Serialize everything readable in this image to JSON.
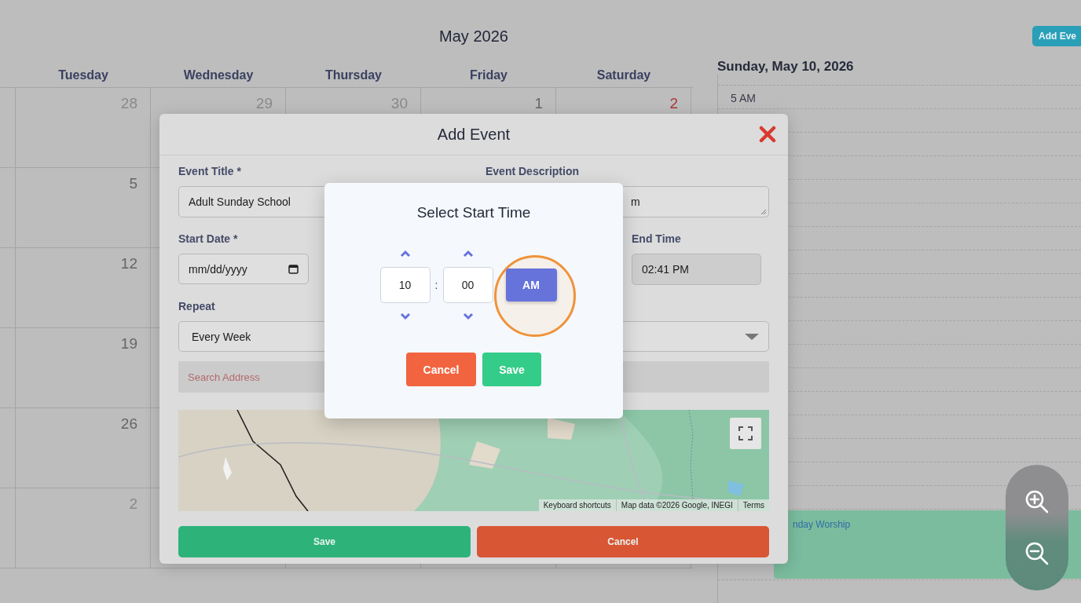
{
  "calendar": {
    "title": "May 2026",
    "weekdays": [
      "Tuesday",
      "Wednesday",
      "Thursday",
      "Friday",
      "Saturday"
    ],
    "weeks": [
      {
        "cells": [
          {
            "day": "28",
            "muted": true,
            "weekend": false
          },
          {
            "day": "29",
            "muted": true,
            "weekend": false
          },
          {
            "day": "30",
            "muted": true,
            "weekend": false
          },
          {
            "day": "1",
            "muted": false,
            "weekend": false
          },
          {
            "day": "2",
            "muted": false,
            "weekend": true
          }
        ]
      },
      {
        "cells": [
          {
            "day": "5",
            "muted": false,
            "weekend": false
          }
        ]
      },
      {
        "cells": [
          {
            "day": "12",
            "muted": false,
            "weekend": false
          }
        ]
      },
      {
        "cells": [
          {
            "day": "19",
            "muted": false,
            "weekend": false
          }
        ]
      },
      {
        "cells": [
          {
            "day": "26",
            "muted": false,
            "weekend": false
          }
        ]
      },
      {
        "cells": [
          {
            "day": "2",
            "muted": true,
            "weekend": false
          }
        ]
      }
    ]
  },
  "add_event_button": "Add Eve",
  "day_view": {
    "title": "Sunday, May 10, 2026",
    "first_slot": "5 AM",
    "event": "nday Worship"
  },
  "add_event_dialog": {
    "title": "Add Event",
    "event_title": {
      "label": "Event Title *",
      "value": "Adult Sunday School"
    },
    "event_description": {
      "label": "Event Description",
      "value": "m"
    },
    "start_date": {
      "label": "Start Date *",
      "value": "mm/dd/yyyy"
    },
    "end_time": {
      "label": "End Time",
      "value": "02:41 PM"
    },
    "repeat": {
      "label": "Repeat",
      "value": "Every Week"
    },
    "search_address": {
      "placeholder": "Search Address"
    },
    "map": {
      "kind": "picture",
      "attribution": [
        "Keyboard shortcuts",
        "Map data ©2026 Google, INEGI",
        "Terms"
      ]
    },
    "buttons": [
      {
        "label": "Save",
        "kind": "save"
      },
      {
        "label": "Cancel",
        "kind": "cancel"
      }
    ]
  },
  "time_picker": {
    "title": "Select Start Time",
    "hour": "10",
    "separator": ":",
    "minute": "00",
    "period": "AM",
    "highlighted": true,
    "buttons": [
      {
        "label": "Cancel",
        "kind": "cancel"
      },
      {
        "label": "Save",
        "kind": "save"
      }
    ]
  }
}
